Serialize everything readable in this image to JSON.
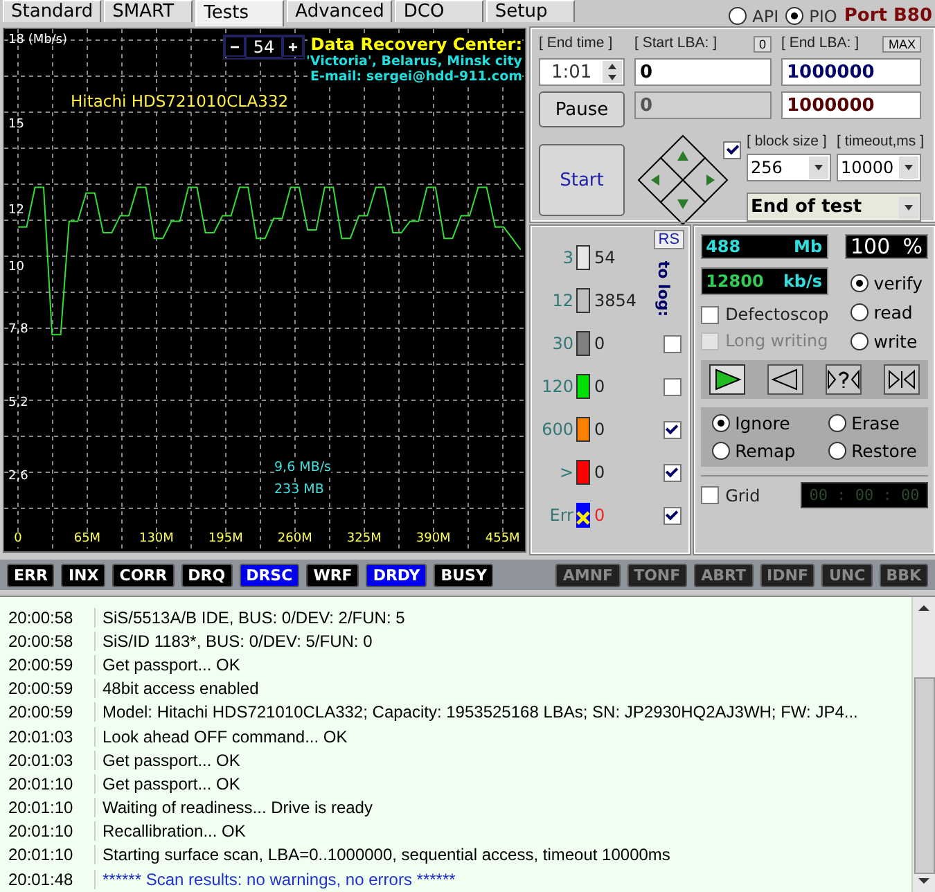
{
  "tabs": [
    {
      "label": "Standard",
      "selected": false
    },
    {
      "label": "SMART",
      "selected": false
    },
    {
      "label": "Tests",
      "selected": true
    },
    {
      "label": "Advanced",
      "selected": false
    },
    {
      "label": "DCO",
      "selected": false
    },
    {
      "label": "Setup",
      "selected": false
    }
  ],
  "interface_modes": [
    {
      "label": "API",
      "selected": false
    },
    {
      "label": "PIO",
      "selected": true
    }
  ],
  "port": "Port B80",
  "graph": {
    "chart_data": {
      "type": "line",
      "xlim": [
        0,
        476
      ],
      "ylim": [
        0,
        18
      ],
      "grid": true,
      "xticks": [
        {
          "value": 0,
          "label": "0"
        },
        {
          "value": 65,
          "label": "65M"
        },
        {
          "value": 130,
          "label": "130M"
        },
        {
          "value": 195,
          "label": "195M"
        },
        {
          "value": 260,
          "label": "260M"
        },
        {
          "value": 325,
          "label": "325M"
        },
        {
          "value": 390,
          "label": "390M"
        },
        {
          "value": 455,
          "label": "455M"
        }
      ],
      "yticks": [
        {
          "value": 18,
          "label": "18 (Mb/s)"
        },
        {
          "value": 15,
          "label": "15"
        },
        {
          "value": 12,
          "label": "12"
        },
        {
          "value": 10,
          "label": "10"
        },
        {
          "value": 7.8,
          "label": "7,8"
        },
        {
          "value": 5.2,
          "label": "5,2"
        },
        {
          "value": 2.6,
          "label": "2,6"
        }
      ],
      "x": [
        0,
        8,
        16,
        24,
        32,
        40,
        48,
        56,
        64,
        72,
        80,
        88,
        96,
        104,
        112,
        120,
        128,
        136,
        144,
        152,
        160,
        168,
        176,
        184,
        192,
        200,
        208,
        216,
        224,
        232,
        240,
        248,
        256,
        264,
        272,
        280,
        288,
        296,
        304,
        312,
        320,
        328,
        336,
        344,
        352,
        360,
        368,
        376,
        384,
        392,
        400,
        408,
        416,
        424,
        432,
        440,
        448,
        456,
        464,
        472
      ],
      "series": [
        {
          "color": "#33dd33",
          "values": [
            11.4,
            11.4,
            12.8,
            12.8,
            7.6,
            7.6,
            11.6,
            11.6,
            12.6,
            12.6,
            11.2,
            11.2,
            11.8,
            11.8,
            12.8,
            12.8,
            11.0,
            11.0,
            11.6,
            11.6,
            12.8,
            12.8,
            11.2,
            11.2,
            11.8,
            11.8,
            12.8,
            12.8,
            11.0,
            11.0,
            11.7,
            11.7,
            12.8,
            12.8,
            11.3,
            11.3,
            12.8,
            12.8,
            11.0,
            11.0,
            11.8,
            11.8,
            12.8,
            12.8,
            11.2,
            11.2,
            11.6,
            11.6,
            12.8,
            12.8,
            11.0,
            11.0,
            11.8,
            11.8,
            12.8,
            12.8,
            11.4,
            11.4,
            11.0,
            10.6
          ]
        }
      ]
    },
    "step_minus": "−",
    "step_value": "54",
    "step_plus": "+",
    "center_title": "Data Recovery Center:",
    "center_lines": [
      "'Victoria', Belarus, Minsk city",
      "E-mail: sergei@hdd-911.com"
    ],
    "drive_model": "Hitachi HDS721010CLA332",
    "speed_reading": "9,6 MB/s",
    "size_reading": "233 MB"
  },
  "controls": {
    "end_time_label": "[ End time ]",
    "end_time": "1:01",
    "start_lba_label": "[ Start LBA: ]",
    "zero_button": "0",
    "start_lba": "0",
    "end_lba_label": "[ End LBA: ]",
    "max_button": "MAX",
    "end_lba": "1000000",
    "current_lba": "0",
    "current_end_lba": "1000000",
    "pause_button": "Pause",
    "start_button": "Start",
    "direction_checked": true,
    "block_size_label": "[ block size ]",
    "block_size": "256",
    "timeout_label": "[ timeout,ms ]",
    "timeout": "10000",
    "finish_action": "End of test"
  },
  "legend": {
    "rs_button": "RS",
    "to_log_label": "to log:",
    "rows": [
      {
        "kind": "counter",
        "threshold": "3",
        "count": "54",
        "color": "#e6e6e6"
      },
      {
        "kind": "counter",
        "threshold": "12",
        "count": "3854",
        "color": "#c0c0c0"
      },
      {
        "kind": "counter",
        "threshold": "30",
        "count": "0",
        "color": "#808080",
        "log": {
          "checked": false
        }
      },
      {
        "kind": "counter",
        "threshold": "120",
        "count": "0",
        "color": "#00e000",
        "log": {
          "checked": false
        }
      },
      {
        "kind": "counter",
        "threshold": "600",
        "count": "0",
        "color": "#ff8000",
        "log": {
          "checked": true
        }
      },
      {
        "kind": "counter",
        "threshold": ">",
        "count": "0",
        "color": "#ff0000",
        "log": {
          "checked": true
        }
      },
      {
        "kind": "error",
        "threshold": "Err",
        "count": "0",
        "color": "#0000ff",
        "log": {
          "checked": true
        }
      }
    ]
  },
  "stats": {
    "mb_value": "488",
    "mb_unit": "Mb",
    "percent_value": "100",
    "percent_unit": "%",
    "speed_value": "12800",
    "speed_unit": "kb/s",
    "modes": [
      {
        "label": "verify",
        "selected": true
      },
      {
        "label": "read",
        "selected": false
      },
      {
        "label": "write",
        "selected": false
      }
    ],
    "options": [
      {
        "label": "Defectoscop",
        "checked": false,
        "disabled": false
      },
      {
        "label": "Long writing",
        "checked": false,
        "disabled": true
      }
    ],
    "scan_buttons": [
      {
        "kind": "play",
        "selected": true
      },
      {
        "kind": "back",
        "selected": false
      },
      {
        "kind": "query",
        "selected": false
      },
      {
        "kind": "pause",
        "selected": false
      }
    ],
    "repair_modes": [
      {
        "label": "Ignore",
        "selected": true
      },
      {
        "label": "Erase",
        "selected": false
      },
      {
        "label": "Remap",
        "selected": false
      },
      {
        "label": "Restore",
        "selected": false
      }
    ],
    "grid_label": "Grid",
    "grid_checked": false,
    "timer": "00 : 00 : 00"
  },
  "flags": [
    {
      "label": "ERR",
      "set": false,
      "disabled": false
    },
    {
      "label": "INX",
      "set": false,
      "disabled": false
    },
    {
      "label": "CORR",
      "set": false,
      "disabled": false
    },
    {
      "label": "DRQ",
      "set": false,
      "disabled": false
    },
    {
      "label": "DRSC",
      "set": true,
      "disabled": false
    },
    {
      "label": "WRF",
      "set": false,
      "disabled": false
    },
    {
      "label": "DRDY",
      "set": true,
      "disabled": false
    },
    {
      "label": "BUSY",
      "set": false,
      "disabled": false
    },
    {
      "label": "AMNF",
      "set": false,
      "disabled": true
    },
    {
      "label": "TONF",
      "set": false,
      "disabled": true
    },
    {
      "label": "ABRT",
      "set": false,
      "disabled": true
    },
    {
      "label": "IDNF",
      "set": false,
      "disabled": true
    },
    {
      "label": "UNC",
      "set": false,
      "disabled": true
    },
    {
      "label": "BBK",
      "set": false,
      "disabled": true
    }
  ],
  "log": [
    {
      "time": "20:00:58",
      "message": "SiS/5513A/B IDE, BUS: 0/DEV: 2/FUN: 5",
      "kind": "info"
    },
    {
      "time": "20:00:58",
      "message": "SiS/ID 1183*, BUS: 0/DEV: 5/FUN: 0",
      "kind": "info"
    },
    {
      "time": "20:00:59",
      "message": "Get passport... OK",
      "kind": "info"
    },
    {
      "time": "20:00:59",
      "message": "48bit access enabled",
      "kind": "info"
    },
    {
      "time": "20:00:59",
      "message": "Model: Hitachi HDS721010CLA332; Capacity: 1953525168 LBAs; SN: JP2930HQ2AJ3WH; FW: JP4...",
      "kind": "info"
    },
    {
      "time": "20:01:03",
      "message": "Look ahead OFF command... OK",
      "kind": "info"
    },
    {
      "time": "20:01:03",
      "message": "Get passport... OK",
      "kind": "info"
    },
    {
      "time": "20:01:10",
      "message": "Get passport... OK",
      "kind": "info"
    },
    {
      "time": "20:01:10",
      "message": "Waiting of readiness... Drive is ready",
      "kind": "info"
    },
    {
      "time": "20:01:10",
      "message": "Recallibration... OK",
      "kind": "info"
    },
    {
      "time": "20:01:10",
      "message": "Starting surface scan, LBA=0..1000000, sequential access, timeout 10000ms",
      "kind": "info"
    },
    {
      "time": "20:01:48",
      "message": "****** Scan results: no warnings, no errors ******",
      "kind": "result"
    }
  ]
}
